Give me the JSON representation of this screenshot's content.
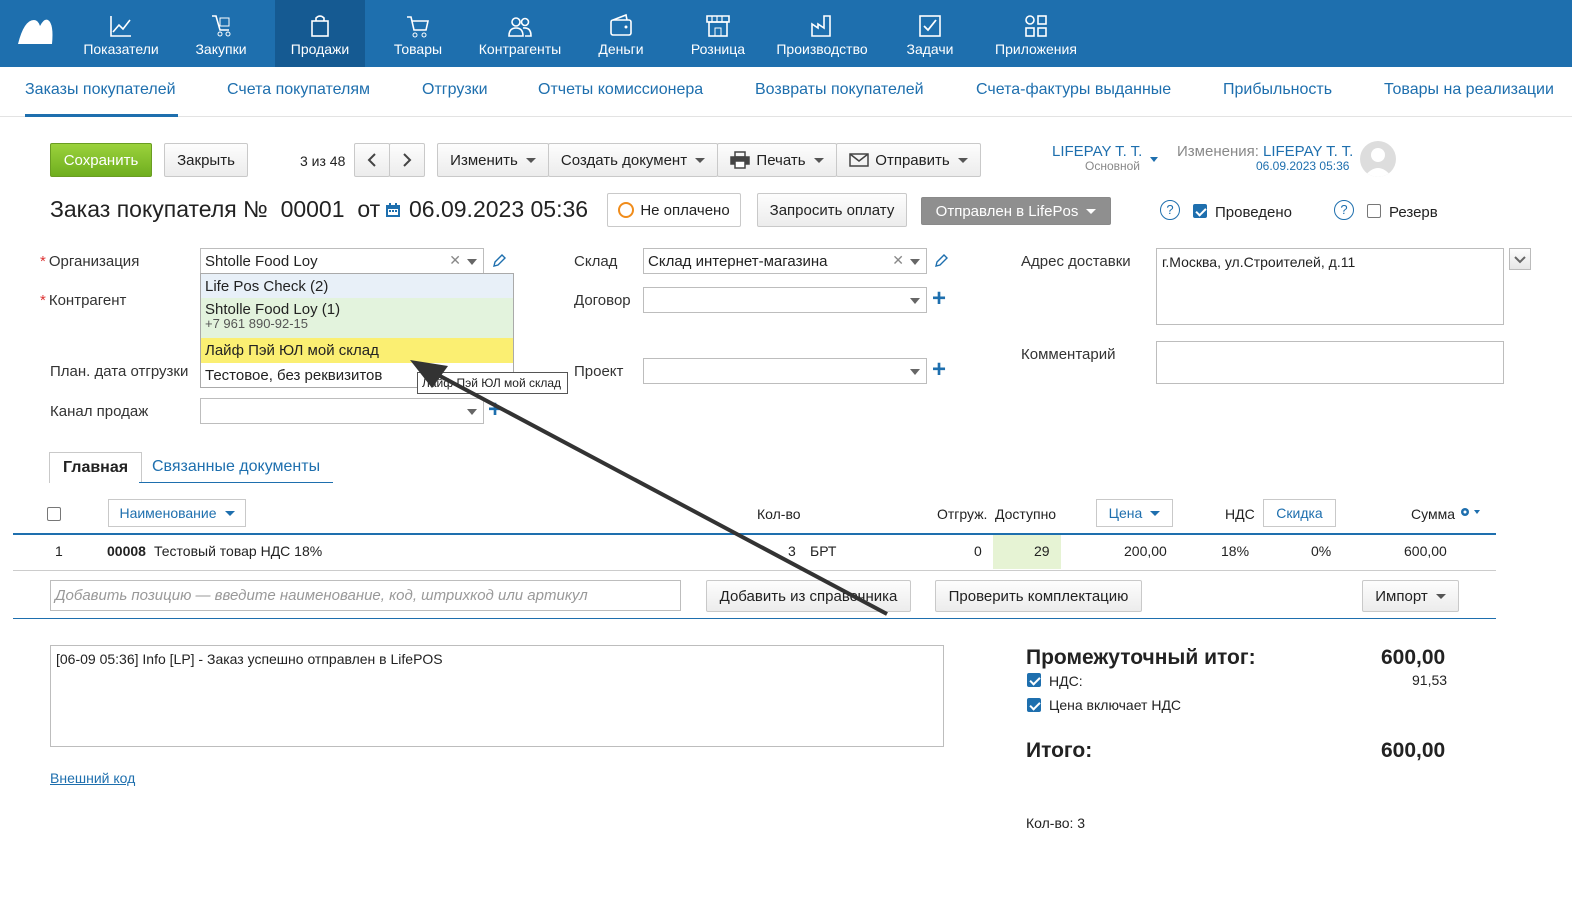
{
  "nav": [
    {
      "label": "Показатели",
      "icon": "chart-line-icon"
    },
    {
      "label": "Закупки",
      "icon": "cart-purchase-icon"
    },
    {
      "label": "Продажи",
      "icon": "shopping-bag-icon"
    },
    {
      "label": "Товары",
      "icon": "shopping-cart-icon"
    },
    {
      "label": "Контрагенты",
      "icon": "people-icon"
    },
    {
      "label": "Деньги",
      "icon": "wallet-icon"
    },
    {
      "label": "Розница",
      "icon": "store-icon"
    },
    {
      "label": "Производство",
      "icon": "factory-icon"
    },
    {
      "label": "Задачи",
      "icon": "task-check-icon"
    },
    {
      "label": "Приложения",
      "icon": "apps-icon"
    }
  ],
  "subnav": [
    "Заказы покупателей",
    "Счета покупателям",
    "Отгрузки",
    "Отчеты комиссионера",
    "Возвраты покупателей",
    "Счета-фактуры выданные",
    "Прибыльность",
    "Товары на реализации"
  ],
  "toolbar": {
    "save": "Сохранить",
    "close": "Закрыть",
    "pager": "3 из 48",
    "edit": "Изменить",
    "create_doc": "Создать документ",
    "print": "Печать",
    "send": "Отправить"
  },
  "user": {
    "name": "LIFEPAY T. T.",
    "role": "Основной",
    "changes_label": "Изменения:",
    "changes_user": "LIFEPAY T. T.",
    "changes_date": "06.09.2023 05:36"
  },
  "order": {
    "title": "Заказ покупателя №",
    "number": "00001",
    "from": "от",
    "date": "06.09.2023 05:36",
    "payment_status": "Не оплачено",
    "request_payment": "Запросить оплату",
    "state": "Отправлен в LifePos",
    "posted": "Проведено",
    "reserve": "Резерв"
  },
  "form": {
    "org_label": "Организация",
    "org_value": "Shtolle Food Loy",
    "counterparty_label": "Контрагент",
    "ship_date_label": "План. дата отгрузки",
    "channel_label": "Канал продаж",
    "warehouse_label": "Склад",
    "warehouse_value": "Склад интернет-магазина",
    "contract_label": "Договор",
    "project_label": "Проект",
    "address_label": "Адрес доставки",
    "address_value": "г.Москва, ул.Строителей, д.11",
    "comment_label": "Комментарий"
  },
  "dropdown": {
    "options": [
      {
        "label": "Life Pos Check (2)",
        "sub": ""
      },
      {
        "label": "Shtolle Food Loy (1)",
        "sub": "+7 961 890-92-15"
      },
      {
        "label": "Лайф Пэй ЮЛ мой склад",
        "sub": ""
      },
      {
        "label": "Тестовое, без реквизитов",
        "sub": ""
      }
    ],
    "tooltip": "Лайф Пэй ЮЛ мой склад"
  },
  "tabs": [
    "Главная",
    "Связанные документы"
  ],
  "table": {
    "headers": {
      "name": "Наименование",
      "qty": "Кол-во",
      "shipped": "Отгруж.",
      "available": "Доступно",
      "price": "Цена",
      "vat": "НДС",
      "discount": "Скидка",
      "sum": "Сумма"
    },
    "rows": [
      {
        "n": "1",
        "code": "00008",
        "name": "Тестовый товар НДС 18%",
        "qty": "3",
        "unit": "БРТ",
        "shipped": "0",
        "available": "29",
        "price": "200,00",
        "vat": "18%",
        "discount": "0%",
        "sum": "600,00"
      }
    ],
    "add_placeholder": "Добавить позицию — введите наименование, код, штрихкод или артикул",
    "add_from_catalog": "Добавить из справочника",
    "check_set": "Проверить комплектацию",
    "import": "Импорт"
  },
  "log": "[06-09 05:36] Info [LP] - Заказ успешно отправлен в LifePOS",
  "external_code": "Внешний код",
  "totals": {
    "subtotal_label": "Промежуточный итог:",
    "subtotal": "600,00",
    "vat_label": "НДС:",
    "vat": "91,53",
    "price_incl_vat": "Цена включает НДС",
    "total_label": "Итого:",
    "total": "600,00",
    "qty": "Кол-во: 3"
  },
  "colors": {
    "brand": "#1e6fae",
    "save": "#7bbb24",
    "highlight": "#fbef72",
    "available_bg": "#e6f3d4"
  }
}
